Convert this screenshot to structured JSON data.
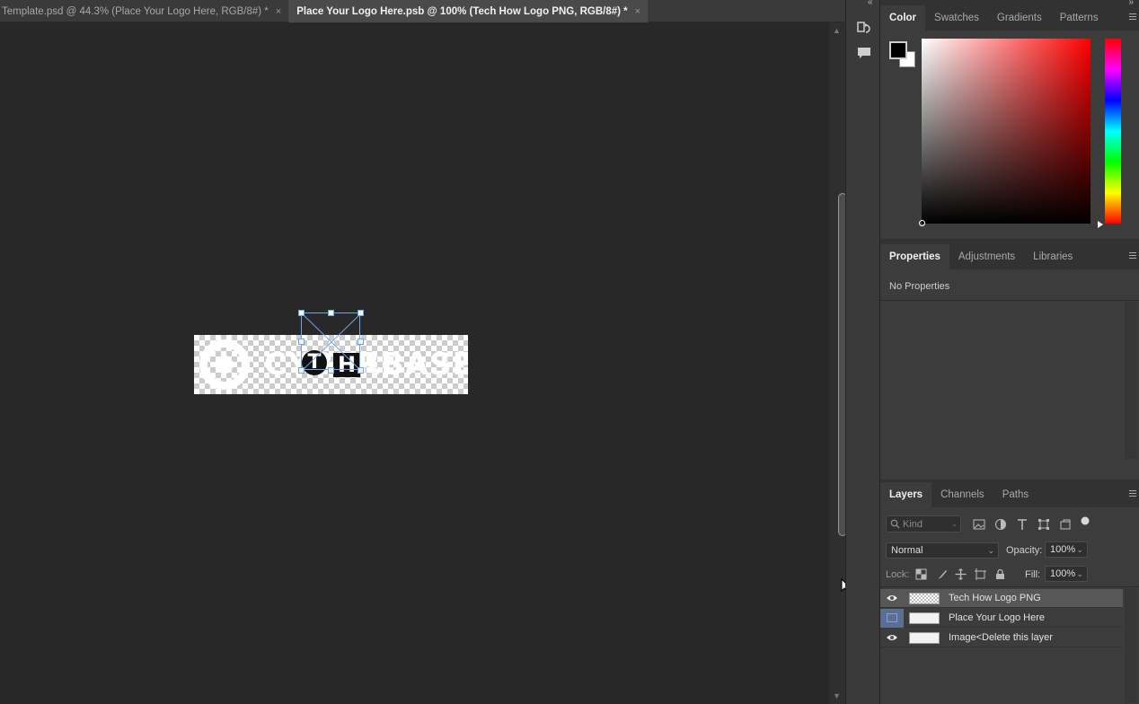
{
  "tabs": [
    {
      "label": "Template.psd @ 44.3% (Place Your Logo Here, RGB/8#) *",
      "close": "×"
    },
    {
      "label": "Place Your Logo Here.psb @ 100% (Tech How Logo PNG, RGB/8#) *",
      "close": "×"
    }
  ],
  "canvas": {
    "ghost_text": "CYBERBASE",
    "logo_letters": [
      "T",
      "H"
    ]
  },
  "color_panel": {
    "tabs": [
      "Color",
      "Swatches",
      "Gradients",
      "Patterns"
    ],
    "foreground": "#000000",
    "background": "#ffffff",
    "hue": "#ff0000"
  },
  "properties_panel": {
    "tabs": [
      "Properties",
      "Adjustments",
      "Libraries"
    ],
    "empty_text": "No Properties"
  },
  "layers_panel": {
    "tabs": [
      "Layers",
      "Channels",
      "Paths"
    ],
    "search_placeholder": "Kind",
    "blend_mode": "Normal",
    "opacity_label": "Opacity:",
    "opacity_value": "100%",
    "lock_label": "Lock:",
    "fill_label": "Fill:",
    "fill_value": "100%",
    "layers": [
      {
        "name": "Tech How Logo PNG",
        "visible": true,
        "selected": true
      },
      {
        "name": "Place Your Logo Here",
        "visible": false,
        "selected": false
      },
      {
        "name": "Image<Delete this layer",
        "visible": true,
        "selected": false
      }
    ]
  },
  "icons": {
    "collapse_left": "«",
    "collapse_right": "»",
    "scroll_up": "▲",
    "scroll_down": "▼"
  }
}
